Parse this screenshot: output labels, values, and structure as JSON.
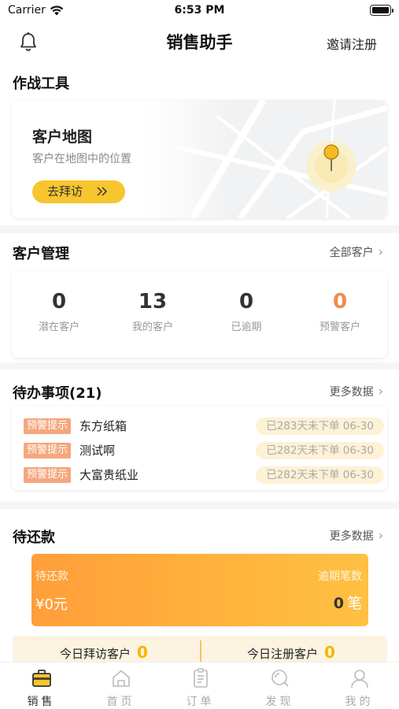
{
  "status_bar": {
    "carrier": "Carrier",
    "time": "6:53 PM"
  },
  "header": {
    "title": "销售助手",
    "invite": "邀请注册"
  },
  "tools": {
    "title": "作战工具",
    "map_card": {
      "title": "客户地图",
      "subtitle": "客户在地图中的位置",
      "button": "去拜访"
    }
  },
  "customers": {
    "title": "客户管理",
    "more": "全部客户",
    "stats": [
      {
        "value": "0",
        "label": "潜在客户"
      },
      {
        "value": "13",
        "label": "我的客户"
      },
      {
        "value": "0",
        "label": "已逾期"
      },
      {
        "value": "0",
        "label": "预警客户"
      }
    ],
    "warning_color": "#f08a4b"
  },
  "todo": {
    "title": "待办事项(21)",
    "more": "更多数据",
    "items": [
      {
        "tag": "预警提示",
        "name": "东方纸箱",
        "status": "已283天未下单 06-30"
      },
      {
        "tag": "预警提示",
        "name": "测试啊",
        "status": "已282天未下单 06-30"
      },
      {
        "tag": "预警提示",
        "name": "大富贵纸业",
        "status": "已282天未下单 06-30"
      }
    ]
  },
  "repayment": {
    "title": "待还款",
    "more": "更多数据",
    "left_label": "待还款",
    "left_value": "¥0元",
    "right_label": "逾期笔数",
    "right_count": "0",
    "right_unit": "笔",
    "today_visits_label": "今日拜访客户",
    "today_visits_value": "0",
    "today_regs_label": "今日注册客户",
    "today_regs_value": "0"
  },
  "tabs": [
    {
      "label": "销售",
      "icon": "briefcase-icon",
      "active": true
    },
    {
      "label": "首页",
      "icon": "home-icon",
      "active": false
    },
    {
      "label": "订单",
      "icon": "order-icon",
      "active": false
    },
    {
      "label": "发现",
      "icon": "discover-icon",
      "active": false
    },
    {
      "label": "我的",
      "icon": "profile-icon",
      "active": false
    }
  ],
  "colors": {
    "accent": "#f7c52c",
    "orange": "#ff9e3a",
    "tag": "#f5a77e"
  }
}
